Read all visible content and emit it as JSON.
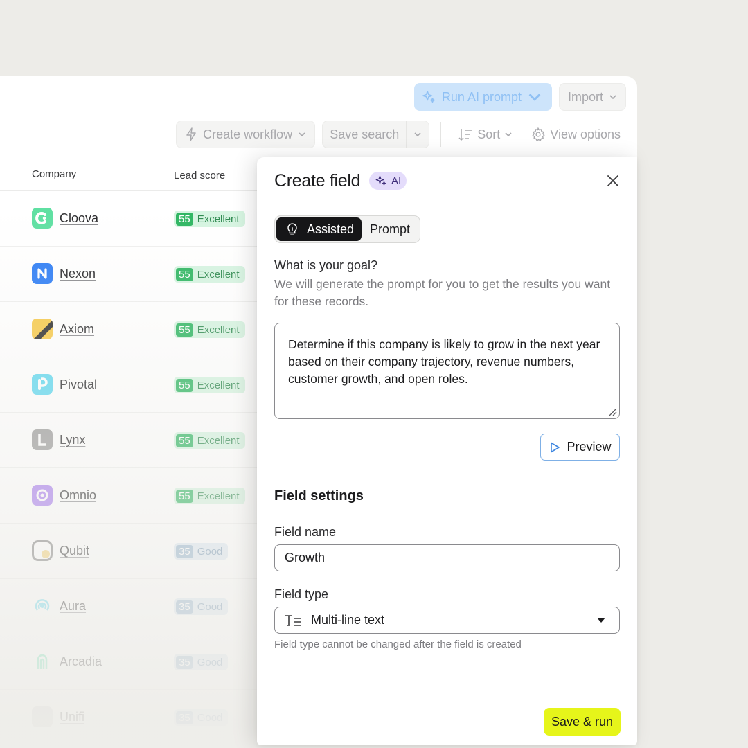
{
  "toolbar": {
    "run_ai_label": "Run AI prompt",
    "import_label": "Import",
    "create_workflow_label": "Create workflow",
    "save_search_label": "Save search",
    "sort_label": "Sort",
    "view_options_label": "View options"
  },
  "table": {
    "columns": [
      "Company",
      "Lead score"
    ],
    "rows": [
      {
        "company": "Cloova",
        "score": "55",
        "rating": "Excellent"
      },
      {
        "company": "Nexon",
        "score": "55",
        "rating": "Excellent"
      },
      {
        "company": "Axiom",
        "score": "55",
        "rating": "Excellent"
      },
      {
        "company": "Pivotal",
        "score": "55",
        "rating": "Excellent"
      },
      {
        "company": "Lynx",
        "score": "55",
        "rating": "Excellent"
      },
      {
        "company": "Omnio",
        "score": "55",
        "rating": "Excellent"
      },
      {
        "company": "Qubit",
        "score": "35",
        "rating": "Good"
      },
      {
        "company": "Aura",
        "score": "35",
        "rating": "Good"
      },
      {
        "company": "Arcadia",
        "score": "35",
        "rating": "Good"
      },
      {
        "company": "Unifi",
        "score": "35",
        "rating": "Good"
      }
    ]
  },
  "panel": {
    "title": "Create field",
    "badge": "AI",
    "tabs": [
      "Assisted",
      "Prompt"
    ],
    "goal_label": "What is your goal?",
    "goal_help": "We will generate the prompt for you to get the results you want for these records.",
    "goal_text": "Determine if this company is likely to grow in the next year based on their company trajectory, revenue numbers, customer growth, and open roles.",
    "preview_label": "Preview",
    "settings_title": "Field settings",
    "field_name_label": "Field name",
    "field_name_value": "Growth",
    "field_type_label": "Field type",
    "field_type_value": "Multi-line text",
    "field_type_help": "Field type cannot be changed after the field is created",
    "save_run_label": "Save & run"
  },
  "colors": {
    "accent_ai": "#cde4fb",
    "excellent": "#2fb662",
    "good": "#8fb0cc",
    "save_button": "#e6f51a",
    "ai_badge": "#e4dcfb"
  }
}
